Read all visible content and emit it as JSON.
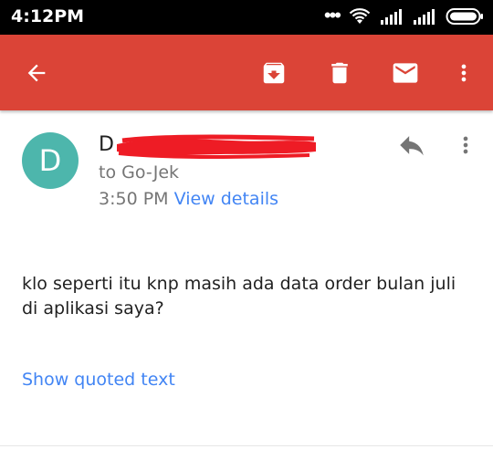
{
  "status_bar": {
    "time": "4:12PM"
  },
  "app_bar": {
    "icons": [
      "back-arrow-icon",
      "archive-icon",
      "delete-icon",
      "mark-unread-icon",
      "more-vert-icon"
    ],
    "color": "#db4437"
  },
  "email": {
    "avatar_letter": "D",
    "avatar_color": "#4db6ac",
    "sender_visible": "D",
    "recipient": "to Go-Jek",
    "time": "3:50 PM",
    "view_details": "View details",
    "body": "klo seperti itu knp masih ada data order bulan juli di aplikasi saya?",
    "show_quoted": "Show quoted text",
    "link_color": "#4285f4"
  }
}
